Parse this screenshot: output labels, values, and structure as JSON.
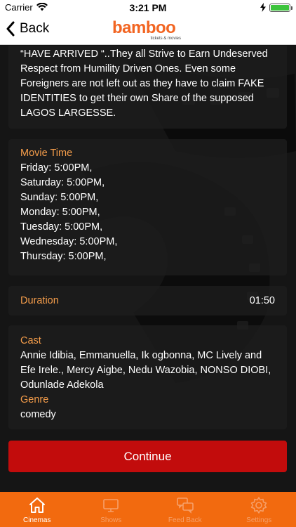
{
  "status_bar": {
    "carrier": "Carrier",
    "time": "3:21 PM"
  },
  "nav": {
    "back_label": "Back",
    "logo_text": "bamboo",
    "logo_tagline": "tickets & movies"
  },
  "description": {
    "text": "“HAVE ARRIVED “..They all Strive to Earn Undeserved Respect from Humility Driven Ones. Even some Foreigners are not left out as they have to claim FAKE IDENTITIES to get their own Share of the supposed LAGOS LARGESSE."
  },
  "movie_time": {
    "label": "Movie Time",
    "times": [
      "Friday: 5:00PM,",
      "Saturday: 5:00PM,",
      "Sunday: 5:00PM,",
      "Monday: 5:00PM,",
      "Tuesday: 5:00PM,",
      "Wednesday: 5:00PM,",
      "Thursday: 5:00PM,"
    ]
  },
  "duration": {
    "label": "Duration",
    "value": "01:50"
  },
  "cast": {
    "label": "Cast",
    "value": "Annie Idibia, Emmanuella, Ik ogbonna, MC Lively and Efe Irele., Mercy Aigbe, Nedu Wazobia, NONSO DIOBI, Odunlade Adekola"
  },
  "genre": {
    "label": "Genre",
    "value": "comedy"
  },
  "continue_label": "Continue",
  "tabs": [
    {
      "label": "Cinemas",
      "icon": "home-icon",
      "active": true
    },
    {
      "label": "Shows",
      "icon": "tv-icon",
      "active": false
    },
    {
      "label": "Feed Back",
      "icon": "chat-bubbles-icon",
      "active": false
    },
    {
      "label": "Settings",
      "icon": "gear-icon",
      "active": false
    }
  ],
  "colors": {
    "accent": "#f39c4a",
    "tab_bar": "#f26a0f",
    "button": "#c20c0c",
    "brand": "#f26522"
  }
}
